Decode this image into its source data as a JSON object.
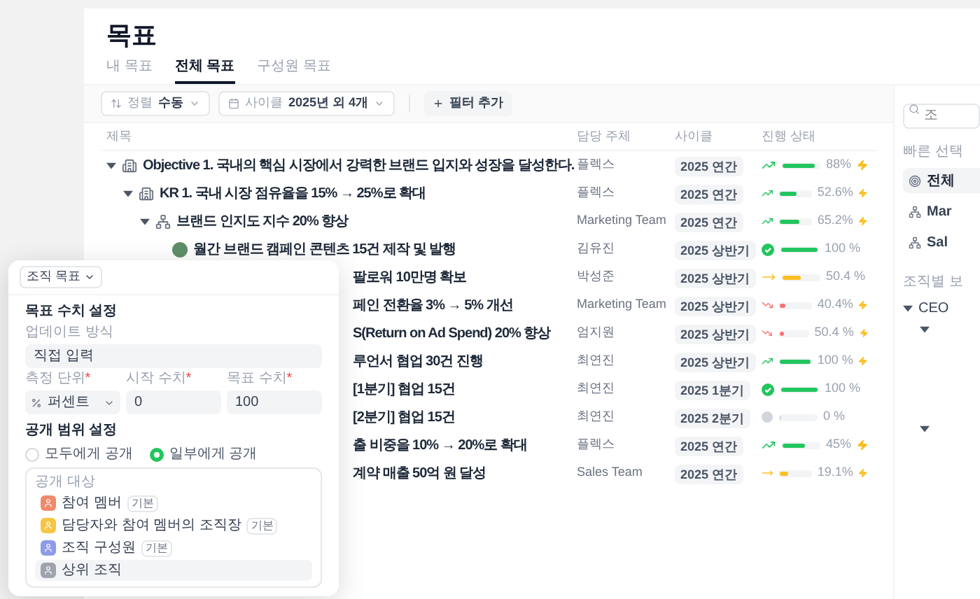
{
  "page": {
    "title": "목표"
  },
  "tabs": [
    {
      "label": "내 목표",
      "selected": false
    },
    {
      "label": "전체 목표",
      "selected": true
    },
    {
      "label": "구성원 목표",
      "selected": false
    }
  ],
  "filters": {
    "sort": {
      "label": "정렬",
      "value": "수동"
    },
    "cycle": {
      "label": "사이클",
      "value": "2025년 외 4개"
    },
    "add_button": "필터 추가"
  },
  "table": {
    "columns": [
      "제목",
      "담당 주체",
      "사이클",
      "진행 상태"
    ],
    "rows": [
      {
        "kind": "objective",
        "title": "Objective 1. 국내의 핵심 시장에서 강력한 브랜드 입지와 성장을 달성한다.",
        "owner": "플렉스",
        "cycle": "2025 연간",
        "progress": {
          "kind": "up",
          "level": 0.88,
          "percent": "88%",
          "flagged": true
        },
        "expanded": true,
        "children": [
          {
            "kind": "objective",
            "title": "KR 1. 국내 시장 점유율을 15% → 25%로 확대",
            "owner": "플렉스",
            "cycle": "2025 연간",
            "progress": {
              "kind": "up",
              "level": 0.526,
              "percent": "52.6%",
              "flagged": true
            },
            "expanded": true,
            "children": [
              {
                "kind": "team",
                "title": "브랜드 인지도 지수 20% 향상",
                "owner": "Marketing Team",
                "cycle": "2025 연간",
                "progress": {
                  "kind": "up",
                  "level": 0.652,
                  "percent": "65.2%",
                  "flagged": true
                },
                "expanded": true,
                "children": [
                  {
                    "kind": "person",
                    "title": "월간 브랜드 캠페인 콘텐츠 15건 제작 및 발행",
                    "owner": "김유진",
                    "cycle": "2025 상반기",
                    "progress": {
                      "kind": "done",
                      "level": 1,
                      "percent": "100 %",
                      "flagged": false
                    }
                  },
                  {
                    "kind": "partial",
                    "title": "팔로워 10만명 확보",
                    "owner": "박성준",
                    "cycle": "2025 상반기",
                    "progress": {
                      "kind": "flat",
                      "level": 0.5,
                      "percent": "50.4 %",
                      "flagged": false
                    }
                  },
                  {
                    "kind": "partial",
                    "title": "페인 전환율 3% → 5% 개선",
                    "owner": "Marketing Team",
                    "cycle": "2025 상반기",
                    "progress": {
                      "kind": "down",
                      "level": 0.15,
                      "percent": "40.4%",
                      "flagged": true
                    }
                  },
                  {
                    "kind": "partial",
                    "title": "S(Return on Ad Spend) 20% 향상",
                    "owner": "엄지원",
                    "cycle": "2025 상반기",
                    "progress": {
                      "kind": "down",
                      "level": 0.15,
                      "percent": "50.4 %",
                      "flagged": true
                    }
                  },
                  {
                    "kind": "partial",
                    "title": "루언서 협업 30건 진행",
                    "owner": "최연진",
                    "cycle": "2025 상반기",
                    "progress": {
                      "kind": "up",
                      "level": 1,
                      "percent": "100 %",
                      "flagged": true
                    }
                  },
                  {
                    "kind": "partial",
                    "title": "[1분기] 협업 15건",
                    "owner": "최연진",
                    "cycle": "2025 1분기",
                    "progress": {
                      "kind": "done",
                      "level": 1,
                      "percent": "100 %",
                      "flagged": false
                    }
                  },
                  {
                    "kind": "partial",
                    "title": "[2분기] 협업 15건",
                    "owner": "최연진",
                    "cycle": "2025 2분기",
                    "progress": {
                      "kind": "none",
                      "level": 0,
                      "percent": "0 %",
                      "flagged": false
                    }
                  },
                  {
                    "kind": "partial",
                    "title": "출 비중을 10% → 20%로 확대",
                    "owner": "플렉스",
                    "cycle": "2025 연간",
                    "progress": {
                      "kind": "up",
                      "level": 0.6,
                      "percent": "45%",
                      "flagged": true
                    }
                  },
                  {
                    "kind": "partial",
                    "title": "계약 매출 50억 원 달성",
                    "owner": "Sales Team",
                    "cycle": "2025 연간",
                    "progress": {
                      "kind": "flat",
                      "level": 0.25,
                      "percent": "19.1%",
                      "flagged": true
                    }
                  }
                ]
              }
            ]
          }
        ]
      }
    ]
  },
  "sidebar": {
    "search": {
      "placeholder": "조"
    },
    "quick_title": "빠른 선택",
    "quick_items": [
      {
        "kind": "all",
        "label": "전체",
        "selected": true
      },
      {
        "kind": "team",
        "label": "Mar",
        "selected": false
      },
      {
        "kind": "team",
        "label": "Sal",
        "selected": false
      }
    ],
    "org_title": "조직별 보",
    "tree": [
      {
        "label": "CEO",
        "expanded": true,
        "children": [
          {
            "expanded": true
          },
          {
            "expanded": true
          }
        ]
      }
    ]
  },
  "panel": {
    "type_button": "조직 목표",
    "numbers_title": "목표 수치 설정",
    "update_label": "업데이트 방식",
    "update_value": "직접 입력",
    "fields": [
      {
        "kind": "select",
        "label": "측정 단위",
        "required_mark": "*",
        "value": "퍼센트"
      },
      {
        "kind": "input",
        "label": "시작 수치",
        "required_mark": "*",
        "value": "0"
      },
      {
        "kind": "input",
        "label": "목표 수치",
        "required_mark": "*",
        "value": "100"
      }
    ],
    "visibility_title": "공개 범위 설정",
    "options": [
      {
        "label": "모두에게 공개",
        "selected": false
      },
      {
        "label": "일부에게 공개",
        "selected": true
      }
    ],
    "audience_title": "공개 대상",
    "audience": [
      {
        "label": "참여 멤버",
        "tag": "기본",
        "color": "#f08a6c",
        "selected": false
      },
      {
        "label": "담당자와 참여 멤버의 조직장",
        "tag": "기본",
        "color": "#f6c544",
        "selected": false
      },
      {
        "label": "조직 구성원",
        "tag": "기본",
        "color": "#8f9be8",
        "selected": false
      },
      {
        "label": "상위 조직",
        "color": "#9ea3ad",
        "selected": true
      }
    ]
  }
}
